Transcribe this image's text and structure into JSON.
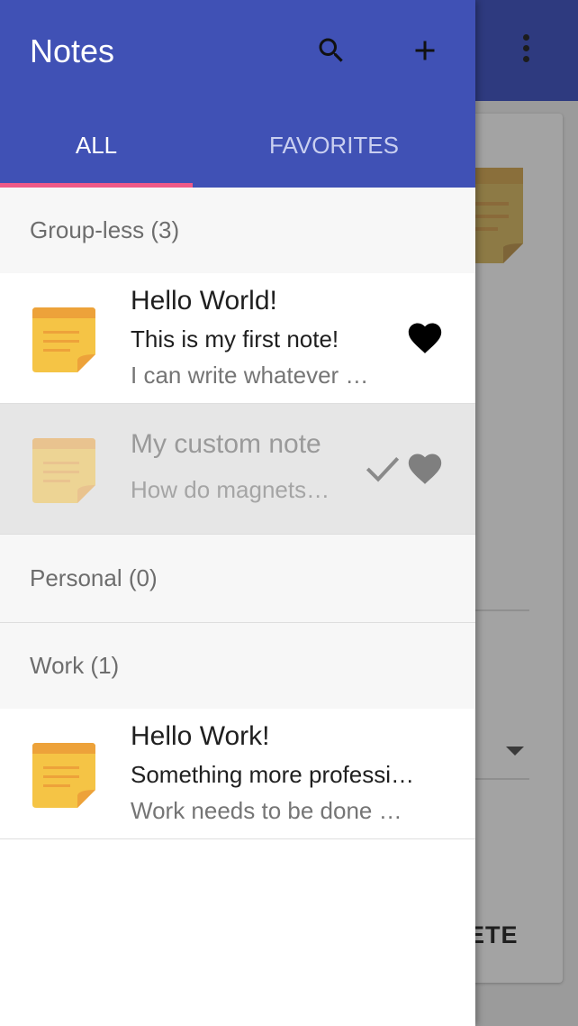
{
  "drawer": {
    "title": "Notes",
    "actions": {
      "search_icon": "search-icon",
      "add_icon": "plus-icon"
    },
    "tabs": [
      {
        "label": "ALL",
        "active": true
      },
      {
        "label": "FAVORITES",
        "active": false
      }
    ]
  },
  "groups": [
    {
      "header": "Group-less (3)",
      "notes": [
        {
          "title": "Hello World!",
          "line1": "This is my first note!",
          "line2": "I can write whatever …",
          "favorite": true,
          "selected": false
        },
        {
          "title": "My custom note",
          "line2": "How do magnets…",
          "favorite": true,
          "selected": true
        }
      ]
    },
    {
      "header": "Personal (0)",
      "notes": []
    },
    {
      "header": "Work (1)",
      "notes": [
        {
          "title": "Hello Work!",
          "line1": "Something more professi…",
          "line2": "Work needs to be done …",
          "favorite": false,
          "selected": false
        }
      ]
    }
  ],
  "background": {
    "button_fragment": "ETE"
  },
  "colors": {
    "appbar": "#4051b5",
    "tab_indicator": "#ef5a88",
    "note_yellow": "#f5c445",
    "note_orange": "#eda23a"
  }
}
